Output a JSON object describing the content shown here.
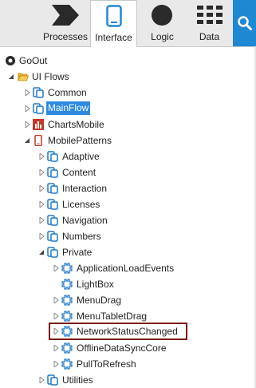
{
  "toolbar": {
    "tabs": [
      {
        "label": "Processes",
        "icon": "processes-chevron-icon"
      },
      {
        "label": "Interface",
        "icon": "mobile-device-icon",
        "active": true
      },
      {
        "label": "Logic",
        "icon": "logic-circle-icon"
      },
      {
        "label": "Data",
        "icon": "data-table-icon"
      }
    ],
    "search_icon": "search-icon",
    "accent": "#1e88d3"
  },
  "tree": {
    "root": "GoOut",
    "ui_flows": "UI Flows",
    "common": "Common",
    "mainflow": "MainFlow",
    "chartsmobile": "ChartsMobile",
    "mobilepatterns": "MobilePatterns",
    "adaptive": "Adaptive",
    "content": "Content",
    "interaction": "Interaction",
    "licenses": "Licenses",
    "navigation": "Navigation",
    "numbers": "Numbers",
    "private": "Private",
    "applicationloadevents": "ApplicationLoadEvents",
    "lightbox": "LightBox",
    "menudrag": "MenuDrag",
    "menutabletdrag": "MenuTabletDrag",
    "networkstatuschanged": "NetworkStatusChanged",
    "offlinedatasynccore": "OfflineDataSyncCore",
    "pulltorefresh": "PullToRefresh",
    "utilities": "Utilities",
    "selection_color": "#2c8ae0",
    "highlight_border_color": "#7a1414"
  }
}
